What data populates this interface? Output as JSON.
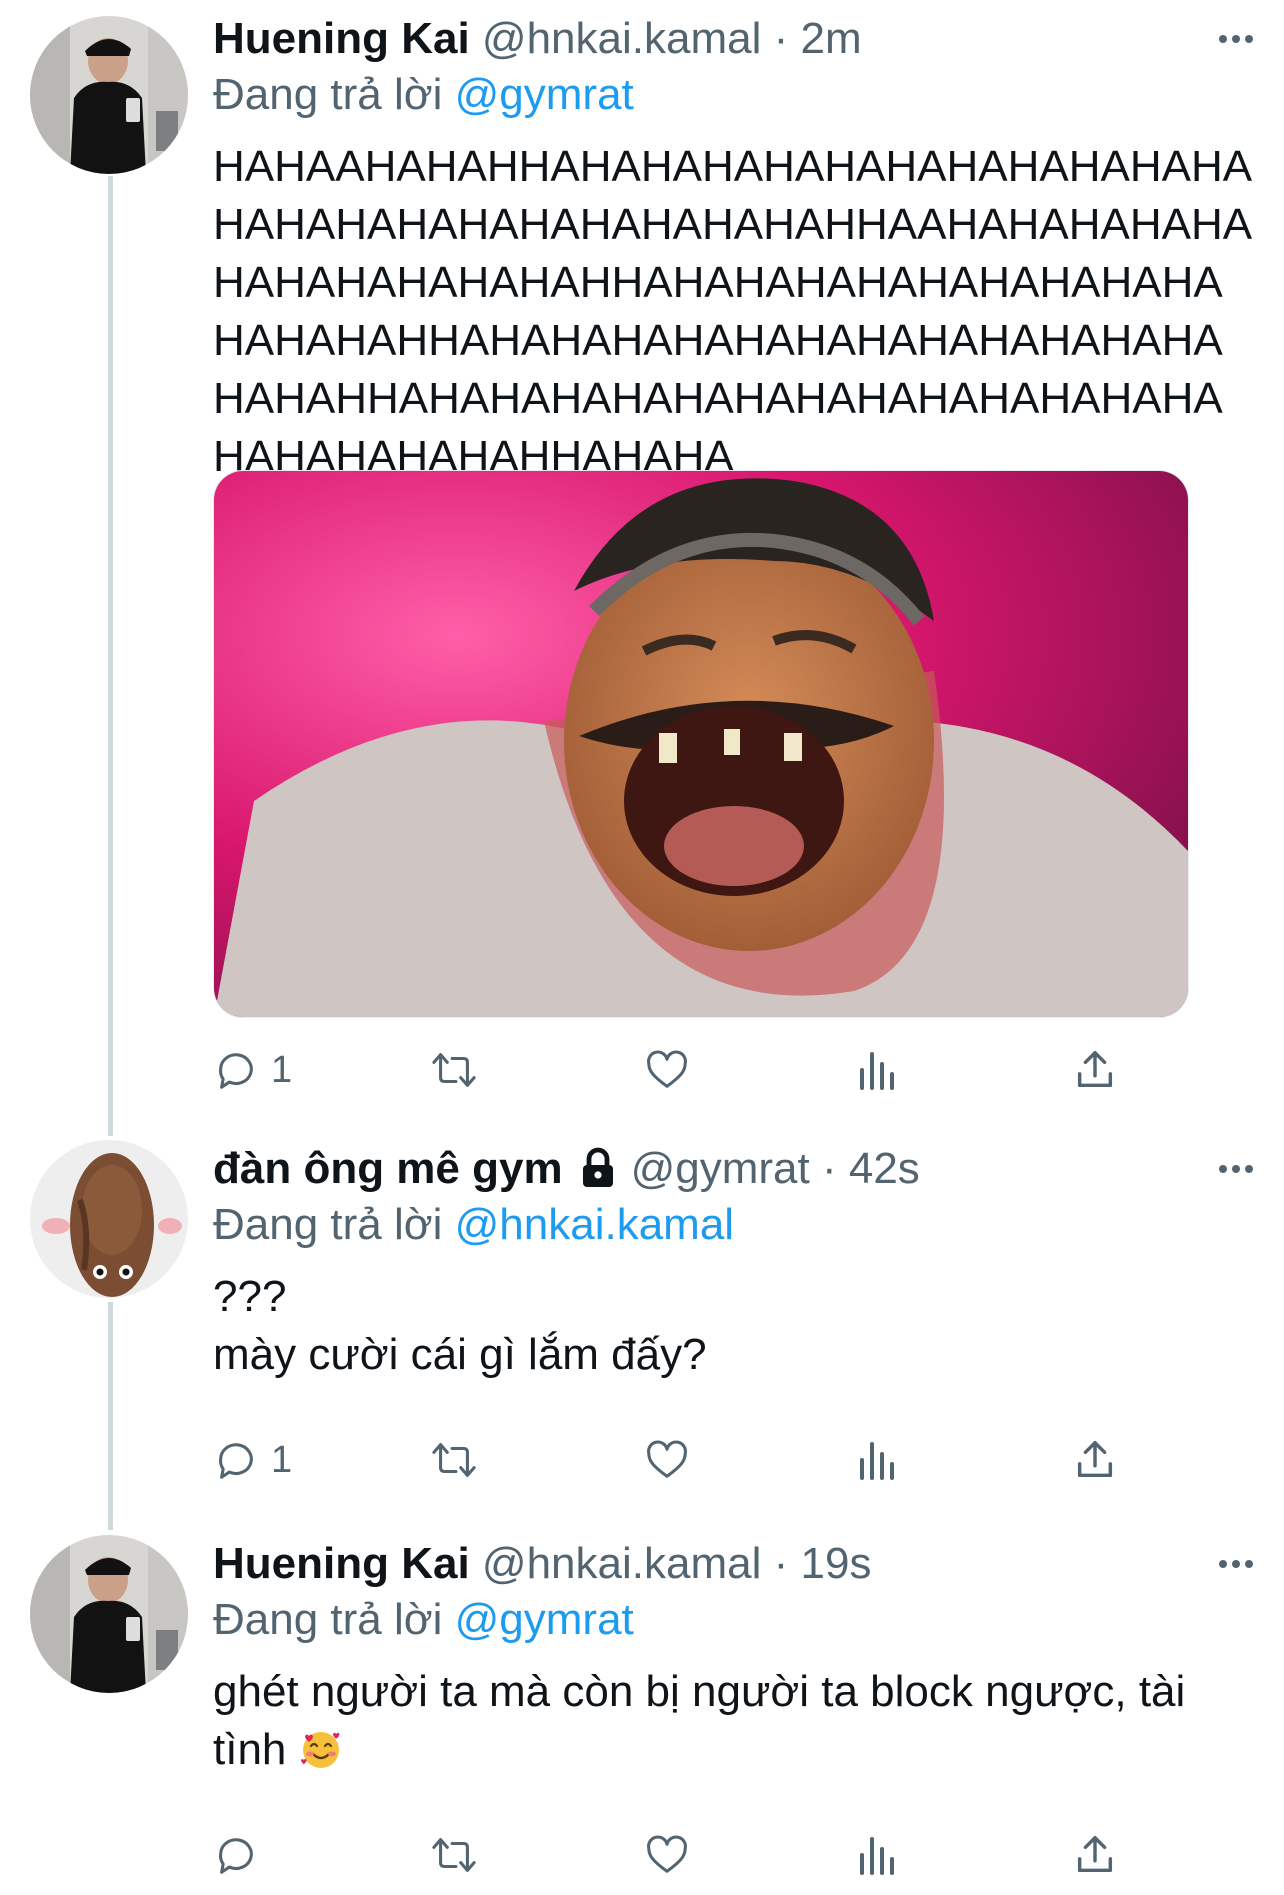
{
  "colors": {
    "text_primary": "#0f1419",
    "text_secondary": "#536471",
    "link": "#1d9bf0",
    "thread_line": "#cfd9de"
  },
  "tweets": [
    {
      "author": {
        "name": "Huening Kai",
        "handle": "@hnkai.kamal",
        "separator": "·",
        "time": "2m",
        "locked": false,
        "avatar": "gym-mirror-selfie-avatar"
      },
      "reply_prefix": "Đang trả lời",
      "reply_to": "@gymrat",
      "text": "HAHAAHAHAHHAHAHAHAHAHAHAHAHAHAHAHAHAHAHAHAHAHAHAHAHAHAHHAAHAHAHAHAHAHAHAHAHAHAHAHHAHAHAHAHAHAHAHAHAHAHAHAHAHHAHAHAHAHAHAHAHAHAHAHAHAHAHAHAHHAHAHAHAHAHAHAHAHAHAHAHAHAHAHAHAHAHAHAHHAHAHA",
      "has_media": true,
      "media": "laughing-man-meme-image",
      "actions": {
        "reply_count": "1",
        "retweet_count": "",
        "like_count": ""
      }
    },
    {
      "author": {
        "name": "đàn ông mê gym",
        "handle": "@gymrat",
        "separator": "·",
        "time": "42s",
        "locked": true,
        "avatar": "potato-character-avatar"
      },
      "reply_prefix": "Đang trả lời",
      "reply_to": "@hnkai.kamal",
      "text": "???\nmày cười cái gì lắm đấy?",
      "has_media": false,
      "actions": {
        "reply_count": "1",
        "retweet_count": "",
        "like_count": ""
      }
    },
    {
      "author": {
        "name": "Huening Kai",
        "handle": "@hnkai.kamal",
        "separator": "·",
        "time": "19s",
        "locked": false,
        "avatar": "gym-mirror-selfie-avatar"
      },
      "reply_prefix": "Đang trả lời",
      "reply_to": "@gymrat",
      "text": "ghét người ta mà còn bị người ta block ngược, tài tình",
      "emoji": "smiling-face-with-hearts",
      "has_media": false,
      "actions": {
        "reply_count": "",
        "retweet_count": "",
        "like_count": ""
      }
    }
  ],
  "icons": {
    "more": "more-horizontal-icon",
    "reply": "reply-bubble-icon",
    "retweet": "retweet-icon",
    "like": "heart-icon",
    "analytics": "analytics-bars-icon",
    "share": "share-upload-icon",
    "lock": "lock-icon"
  }
}
